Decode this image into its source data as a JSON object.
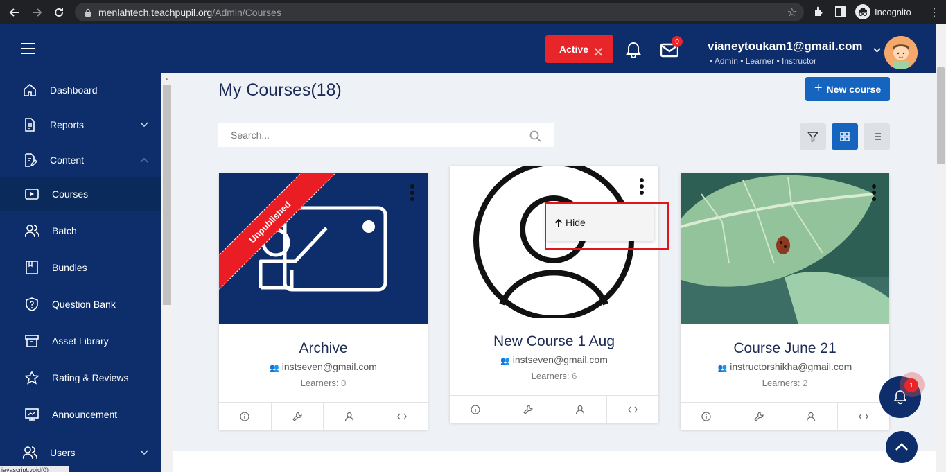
{
  "browser": {
    "url_host": "menlahtech.teachpupil.org",
    "url_path": "/Admin/Courses",
    "incognito_label": "Incognito"
  },
  "header": {
    "status_label": "Active",
    "mail_count": "0",
    "user_email": "vianeytoukam1@gmail.com",
    "user_roles": "• Admin • Learner • Instructor"
  },
  "sidebar": {
    "items": [
      {
        "label": "Dashboard"
      },
      {
        "label": "Reports"
      },
      {
        "label": "Content"
      },
      {
        "label": "Courses"
      },
      {
        "label": "Batch"
      },
      {
        "label": "Bundles"
      },
      {
        "label": "Question Bank"
      },
      {
        "label": "Asset Library"
      },
      {
        "label": "Rating & Reviews"
      },
      {
        "label": "Announcement"
      },
      {
        "label": "Users"
      }
    ]
  },
  "main": {
    "title": "My Courses(18)",
    "new_course_label": "New course",
    "search_placeholder": "Search..."
  },
  "courses": [
    {
      "title": "Archive",
      "owner": "instseven@gmail.com",
      "learners_label": "Learners:",
      "learners": "0",
      "ribbon": "Unpublished"
    },
    {
      "title": "New Course 1 Aug",
      "owner": "instseven@gmail.com",
      "learners_label": "Learners:",
      "learners": "6"
    },
    {
      "title": "Course June 21",
      "owner": "instructorshikha@gmail.com",
      "learners_label": "Learners:",
      "learners": "2"
    }
  ],
  "dropdown": {
    "hide_label": "Hide"
  },
  "notifications": {
    "count": "1"
  },
  "status_bar": "javascript:void(0)",
  "colors": {
    "navy": "#0e2e6b",
    "primary": "#1565c0",
    "danger": "#e8262a"
  }
}
